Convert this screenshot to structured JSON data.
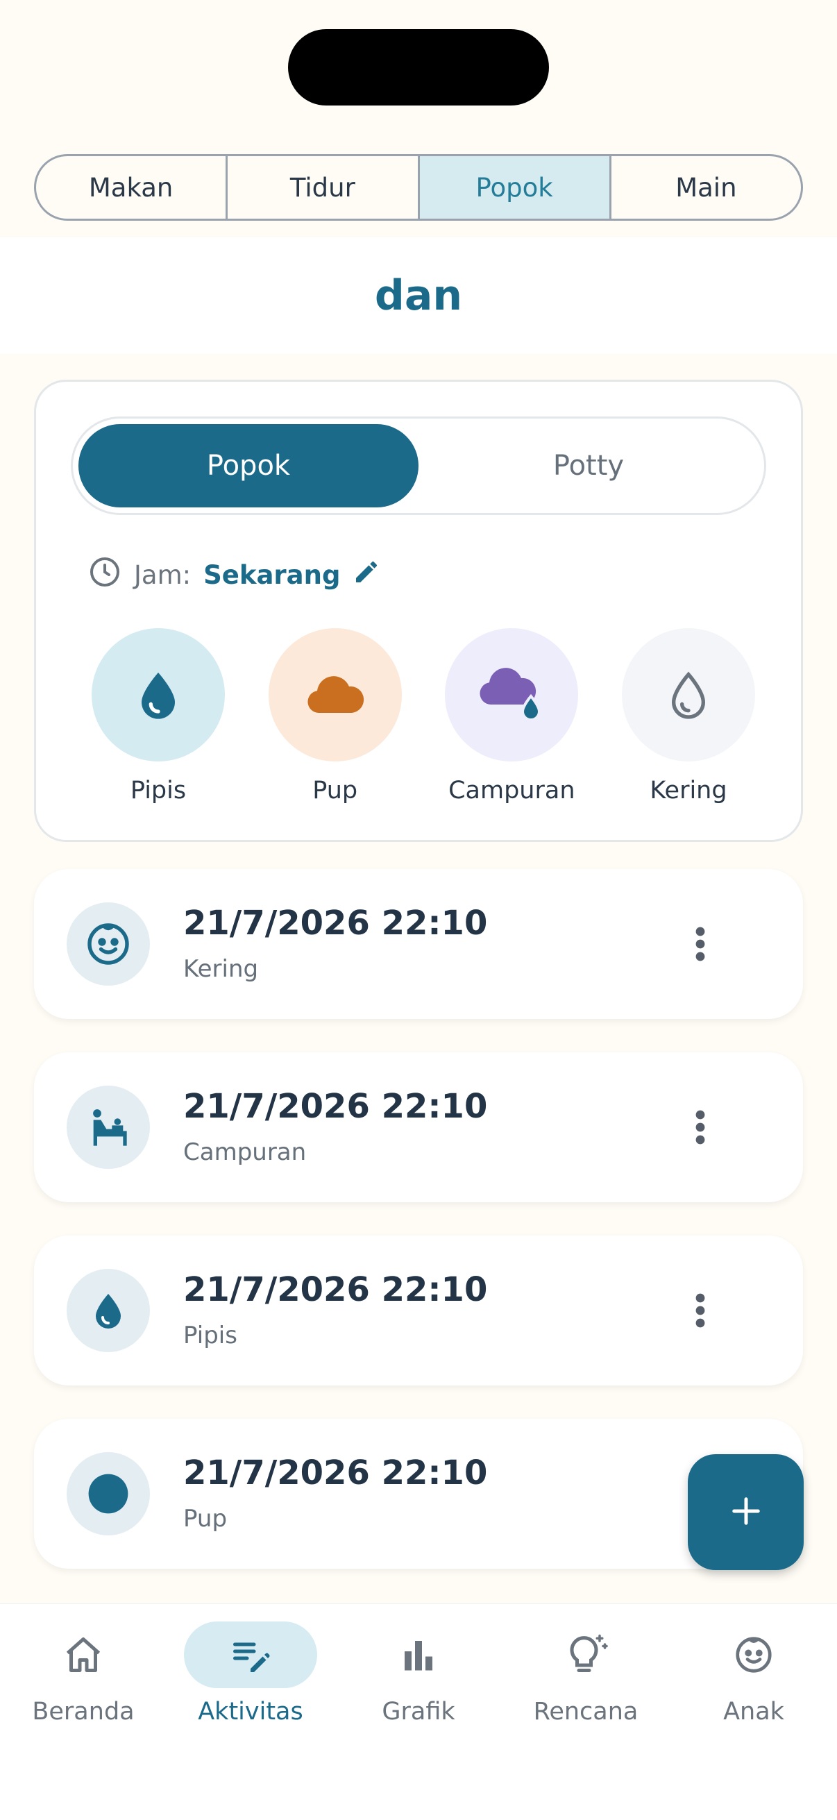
{
  "colors": {
    "primary": "#1C6A8A",
    "background": "#FEFCF5",
    "pipis_bg": "#D4EBF2",
    "pup_bg": "#FDE9D9",
    "pup_color": "#C96F1F",
    "campuran_bg": "#EEEDFB",
    "campuran_color": "#7A5FB5",
    "kering_bg": "#F3F5F8"
  },
  "top_tabs": [
    {
      "label": "Makan",
      "active": false
    },
    {
      "label": "Tidur",
      "active": false
    },
    {
      "label": "Popok",
      "active": true
    },
    {
      "label": "Main",
      "active": false
    }
  ],
  "child_name": "dan",
  "entry": {
    "segment": [
      {
        "label": "Popok",
        "active": true
      },
      {
        "label": "Potty",
        "active": false
      }
    ],
    "time_label": "Jam:",
    "time_value": "Sekarang",
    "types": [
      {
        "label": "Pipis",
        "icon": "droplet-icon"
      },
      {
        "label": "Pup",
        "icon": "cloud-icon"
      },
      {
        "label": "Campuran",
        "icon": "cloud-droplet-icon"
      },
      {
        "label": "Kering",
        "icon": "droplet-outline-icon"
      }
    ]
  },
  "log": [
    {
      "time": "21/7/2026 22:10",
      "type": "Kering",
      "icon": "baby-face-icon"
    },
    {
      "time": "21/7/2026 22:10",
      "type": "Campuran",
      "icon": "changing-table-icon"
    },
    {
      "time": "21/7/2026 22:10",
      "type": "Pipis",
      "icon": "droplet-icon"
    },
    {
      "time": "21/7/2026 22:10",
      "type": "Pup",
      "icon": "circle-icon"
    }
  ],
  "fab_icon": "plus-icon",
  "bottom_nav": [
    {
      "label": "Beranda",
      "icon": "home-icon",
      "active": false
    },
    {
      "label": "Aktivitas",
      "icon": "edit-list-icon",
      "active": true
    },
    {
      "label": "Grafik",
      "icon": "bar-chart-icon",
      "active": false
    },
    {
      "label": "Rencana",
      "icon": "lightbulb-icon",
      "active": false
    },
    {
      "label": "Anak",
      "icon": "baby-face-icon",
      "active": false
    }
  ]
}
